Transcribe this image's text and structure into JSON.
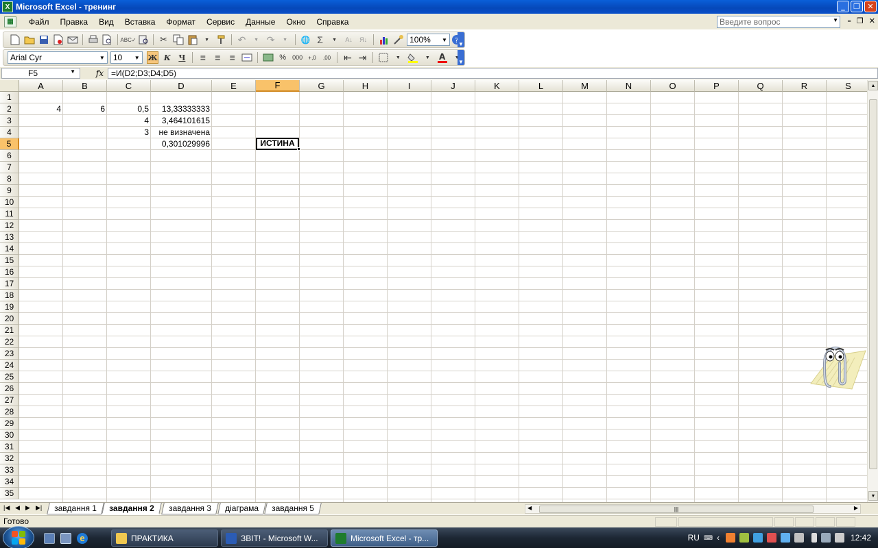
{
  "window": {
    "title": "Microsoft Excel - тренинг",
    "app_icon": "X"
  },
  "menu": {
    "items": [
      "Файл",
      "Правка",
      "Вид",
      "Вставка",
      "Формат",
      "Сервис",
      "Данные",
      "Окно",
      "Справка"
    ],
    "ask_placeholder": "Введите вопрос"
  },
  "toolbar": {
    "zoom": "100%",
    "font_name": "Arial Cyr",
    "font_size": "10",
    "bold": "Ж",
    "italic": "К",
    "underline": "Ч",
    "percent": "%",
    "thousands": "000",
    "inc_dec": "+,0",
    "dec_dec": ",00"
  },
  "formula_bar": {
    "cell_ref": "F5",
    "fx": "fx",
    "formula": "=И(D2;D3;D4;D5)"
  },
  "columns": [
    "A",
    "B",
    "C",
    "D",
    "E",
    "F",
    "G",
    "H",
    "I",
    "J",
    "K",
    "L",
    "M",
    "N",
    "O",
    "P",
    "Q",
    "R",
    "S"
  ],
  "active_cell": {
    "col": "F",
    "row": 5
  },
  "rows": [
    "1",
    "2",
    "3",
    "4",
    "5",
    "6",
    "7",
    "8",
    "9",
    "10",
    "11",
    "12",
    "13",
    "14",
    "15",
    "16",
    "17",
    "18",
    "19",
    "20",
    "21",
    "22",
    "23",
    "24",
    "25",
    "26",
    "27",
    "28",
    "29",
    "30",
    "31",
    "32",
    "33",
    "34",
    "35"
  ],
  "cells": {
    "A2": "4",
    "B2": "6",
    "C2": "0,5",
    "D2": "13,33333333",
    "C3": "4",
    "D3": "3,464101615",
    "C4": "3",
    "D4": "не визначена",
    "D5": "0,301029996",
    "F5": "ИСТИНА"
  },
  "sheets": {
    "tabs": [
      "завдання 1",
      "завдання 2",
      "завдання 3",
      "діаграма",
      "завдання 5"
    ],
    "active_index": 1
  },
  "status": {
    "text": "Готово"
  },
  "taskbar": {
    "tasks": [
      "ПРАКТИКА",
      "ЗВІТ! - Microsoft W...",
      "Microsoft Excel - тр..."
    ],
    "active_task": 2,
    "language": "RU",
    "clock": "12:42"
  },
  "colors": {
    "title_bar": "#0a5fd8",
    "active_header": "#f9c26a",
    "chrome": "#ece9d8",
    "taskbar": "#1d2734"
  }
}
